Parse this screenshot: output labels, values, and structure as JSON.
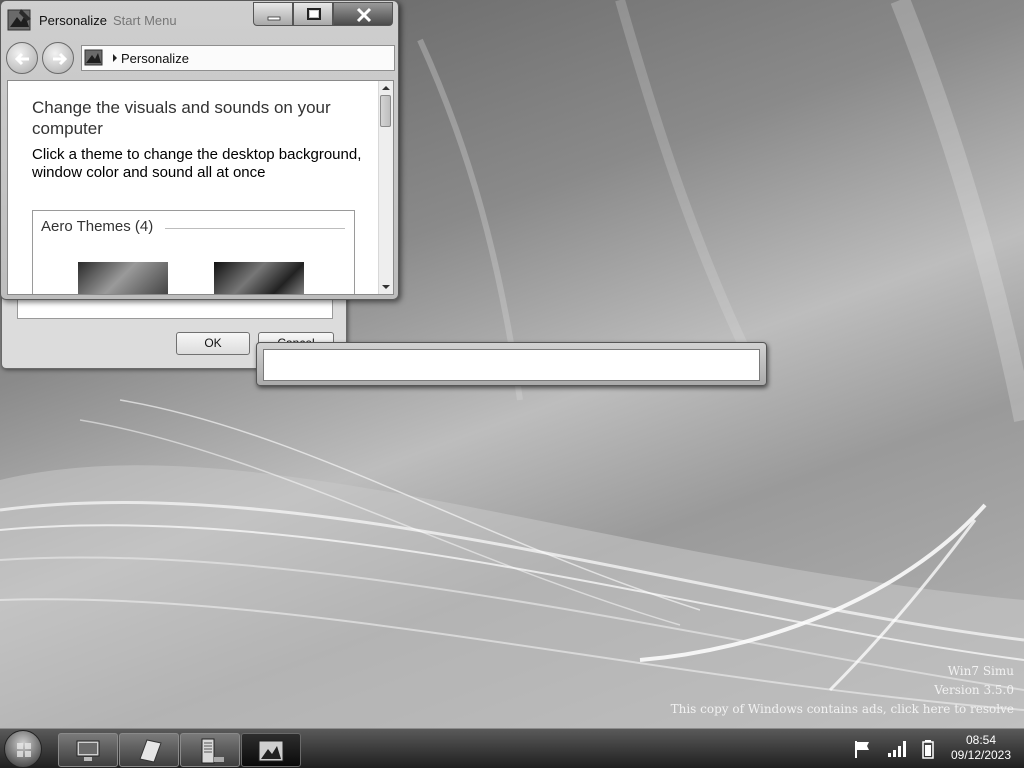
{
  "desktop": {
    "watermark": {
      "line1": "Win7 Simu",
      "line2": "Version 3.5.0",
      "line3": "This copy of Windows contains ads, click here to resolve"
    }
  },
  "back_dialog": {
    "ok_label": "OK",
    "cancel_label": "Cancel"
  },
  "window": {
    "title": "Personalize",
    "title_overlap": "Start Menu",
    "address": {
      "path": "Personalize"
    },
    "heading": "Change the visuals and sounds on your computer",
    "subheading": "Click a theme to change the desktop background, window color and sound all at once",
    "group_title": "Aero Themes (4)"
  },
  "input_dialog": {
    "value": ""
  },
  "taskbar": {
    "clock_time": "08:54",
    "clock_date": "09/12/2023",
    "buttons": [
      "computer-icon",
      "paper-icon",
      "server-icon",
      "personalize-icon"
    ]
  },
  "icons": {
    "start": "windows-orb-icon",
    "tray": [
      "flag-icon",
      "signal-icon",
      "battery-icon"
    ]
  }
}
